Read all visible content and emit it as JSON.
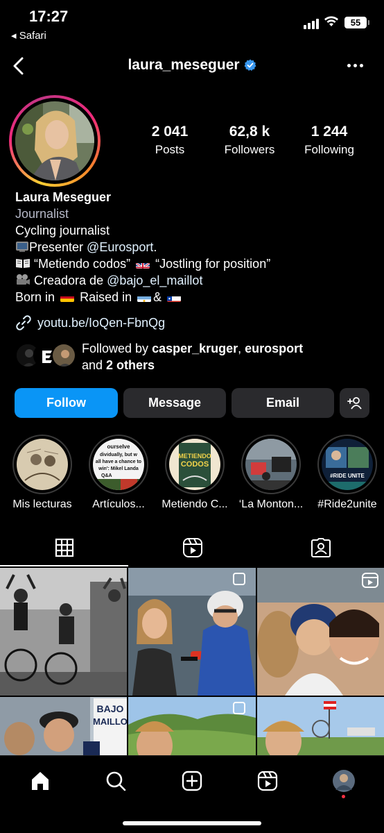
{
  "status": {
    "time": "17:27",
    "back_app": "◂ Safari",
    "battery": "55"
  },
  "header": {
    "username": "laura_meseguer",
    "back_icon": "chevron-left-icon",
    "verified_icon": "verified-badge-icon",
    "more_icon": "more-horizontal-icon"
  },
  "stats": [
    {
      "value": "2 041",
      "label": "Posts"
    },
    {
      "value": "62,8 k",
      "label": "Followers"
    },
    {
      "value": "1 244",
      "label": "Following"
    }
  ],
  "bio": {
    "name": "Laura Meseguer",
    "category": "Journalist",
    "line1": "Cycling journalist",
    "line2_prefix": "Presenter ",
    "line2_mention": "@Eurosport",
    "line2_suffix": ".",
    "line3_a": "“Metiendo codos”",
    "line3_b": "“Jostling for position”",
    "line4_prefix": "Creadora de ",
    "line4_mention": "@bajo_el_maillot",
    "line5_a": "Born in",
    "line5_b": "Raised in",
    "line5_c": "&"
  },
  "link": {
    "text": "youtu.be/IoQen-FbnQg",
    "icon": "link-icon"
  },
  "followed_by": {
    "prefix": "Followed by ",
    "user1": "casper_kruger",
    "sep": ", ",
    "user2": "eurosport",
    "line2_prefix": "and ",
    "others": "2 others"
  },
  "actions": {
    "follow": "Follow",
    "message": "Message",
    "email": "Email",
    "add_icon": "add-person-icon"
  },
  "highlights": [
    {
      "label": "Mis lecturas"
    },
    {
      "label": "Artículos..."
    },
    {
      "label": "Metiendo C..."
    },
    {
      "label": "‘La Monton..."
    },
    {
      "label": "#Ride2unite"
    }
  ],
  "highlight_texts": {
    "h2_text": "ourselve... dividually, but w... all have a chance to win': Mikel Landa",
    "h2_tag": "Q&A",
    "h3_title": "METIENDO CODOS"
  },
  "tabs": [
    "grid-icon",
    "reels-icon",
    "tagged-icon"
  ],
  "grid_texts": {
    "bajo": "BAJO",
    "maillo": "MAILLO"
  },
  "bottom_nav": [
    "home-icon",
    "search-icon",
    "create-icon",
    "reels-icon",
    "profile-avatar"
  ],
  "colors": {
    "accent": "#0a95f6",
    "button": "#2a2a2d",
    "verified": "#3897f0"
  }
}
